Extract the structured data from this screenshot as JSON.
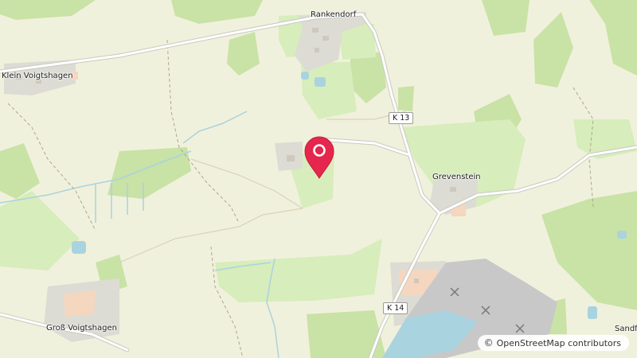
{
  "map": {
    "places": {
      "rankendorf": "Rankendorf",
      "klein_voigtshagen": "Klein Voigtshagen",
      "grevenstein": "Grevenstein",
      "gross_voigtshagen": "Groß Voigtshagen",
      "sandf": "Sandf"
    },
    "roads": {
      "k13": "K 13",
      "k14": "K 14"
    },
    "attribution": {
      "symbol": "©",
      "text": "OpenStreetMap contributors"
    },
    "marker": {
      "icon": "location-pin-icon",
      "color": "#e5264d"
    },
    "colors": {
      "background": "#f0f1dc",
      "forest": "#c9e2a6",
      "meadow": "#d7edbc",
      "water": "#a9d3df",
      "quarry": "#c8c8c8",
      "residential": "#dcdcd4",
      "road": "#ffffff",
      "road_casing": "#c9c9c0"
    }
  }
}
